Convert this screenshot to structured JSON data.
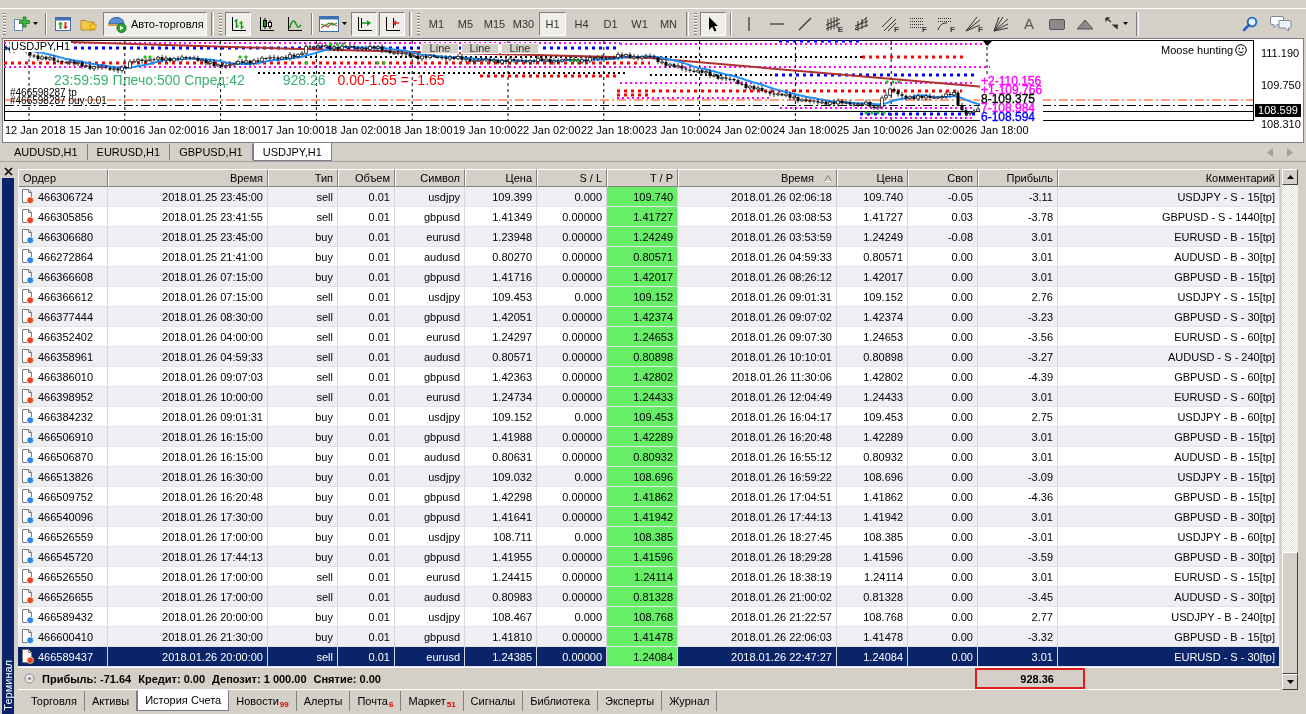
{
  "toolbar": {
    "autotrading": {
      "label": "Авто-торговля",
      "on": true
    },
    "chart_types": [
      {
        "selected": true
      },
      {
        "selected": false
      },
      {
        "selected": false
      }
    ],
    "chart_toggles": [
      {
        "on": true
      },
      {
        "on": true
      }
    ],
    "timeframes": [
      {
        "label": "M1",
        "selected": false
      },
      {
        "label": "M5",
        "selected": false
      },
      {
        "label": "M15",
        "selected": false
      },
      {
        "label": "M30",
        "selected": false
      },
      {
        "label": "H1",
        "selected": true
      },
      {
        "label": "H4",
        "selected": false
      },
      {
        "label": "D1",
        "selected": false
      },
      {
        "label": "W1",
        "selected": false
      },
      {
        "label": "MN",
        "selected": false
      }
    ],
    "drawing_tools": [
      {
        "kind": "icon",
        "selected": true
      },
      {
        "kind": "icon",
        "selected": false
      },
      {
        "kind": "icon",
        "selected": false
      },
      {
        "kind": "icon",
        "selected": false
      },
      {
        "kind": "icon",
        "selected": false,
        "subscript": "E"
      },
      {
        "kind": "icon",
        "selected": false
      },
      {
        "kind": "icon",
        "selected": false,
        "subscript": "F"
      },
      {
        "kind": "icon",
        "selected": false,
        "subscript": "F"
      },
      {
        "kind": "icon",
        "selected": false,
        "subscript": "F"
      },
      {
        "kind": "icon",
        "selected": false,
        "subscript": "F"
      },
      {
        "kind": "icon",
        "selected": false
      },
      {
        "kind": "text",
        "label": "A",
        "selected": false
      },
      {
        "kind": "icon",
        "selected": false
      },
      {
        "kind": "icon",
        "selected": false
      },
      {
        "kind": "dropdown",
        "selected": false
      }
    ]
  },
  "chart": {
    "title": "USDJPY,H1",
    "tags": [
      "Line",
      "Line",
      "Line"
    ],
    "info": "23:59:59 Плечо:500 Спред:42",
    "equity": "928.26",
    "profit": "0.00-1.65 = -1.65",
    "order_labels": [
      "#466598287 tp",
      "#466598287 buy 0.01"
    ],
    "expert": "Moose hunting",
    "levels": [
      {
        "label": "+2-110.156",
        "color": "#ff00ff"
      },
      {
        "label": "+1-109.766",
        "color": "#ff00ff"
      },
      {
        "label": "8-109.375",
        "color": "#000000"
      },
      {
        "label": "7-108.984",
        "color": "#ff00ff"
      },
      {
        "label": "6-108.594",
        "color": "#0000ff"
      }
    ],
    "price_ticks": [
      "111.190",
      "109.750",
      "108.310"
    ],
    "bid": "108.599",
    "time_ticks": [
      "12 Jan 2018",
      "15 Jan 10:00",
      "16 Jan 02:00",
      "16 Jan 18:00",
      "17 Jan 10:00",
      "18 Jan 02:00",
      "18 Jan 18:00",
      "19 Jan 10:00",
      "22 Jan 02:00",
      "22 Jan 18:00",
      "23 Jan 10:00",
      "24 Jan 02:00",
      "24 Jan 18:00",
      "25 Jan 10:00",
      "26 Jan 02:00",
      "26 Jan 18:00"
    ]
  },
  "chart_tabs": [
    {
      "label": "AUDUSD,H1",
      "selected": false
    },
    {
      "label": "EURUSD,H1",
      "selected": false
    },
    {
      "label": "GBPUSD,H1",
      "selected": false
    },
    {
      "label": "USDJPY,H1",
      "selected": true
    }
  ],
  "terminal": {
    "title": "Терминал",
    "table": {
      "columns": [
        {
          "label": "Ордер",
          "sorted": false,
          "highlighted": false
        },
        {
          "label": "Время",
          "sorted": false,
          "highlighted": false
        },
        {
          "label": "Тип",
          "sorted": false,
          "highlighted": false
        },
        {
          "label": "Объем",
          "sorted": false,
          "highlighted": false
        },
        {
          "label": "Символ",
          "sorted": false,
          "highlighted": false
        },
        {
          "label": "Цена",
          "sorted": false,
          "highlighted": false
        },
        {
          "label": "S / L",
          "sorted": false,
          "highlighted": false
        },
        {
          "label": "T / P",
          "sorted": false,
          "highlighted": true
        },
        {
          "label": "Время",
          "sorted": true,
          "highlighted": false
        },
        {
          "label": "Цена",
          "sorted": false,
          "highlighted": false
        },
        {
          "label": "Своп",
          "sorted": false,
          "highlighted": false
        },
        {
          "label": "Прибыль",
          "sorted": false,
          "highlighted": false
        },
        {
          "label": "Комментарий",
          "sorted": false,
          "highlighted": false
        }
      ],
      "rows": [
        {
          "kind": "sell",
          "selected": false,
          "cells": [
            "466306724",
            "2018.01.25 23:45:00",
            "sell",
            "0.01",
            "usdjpy",
            "109.399",
            "0.000",
            "109.740",
            "2018.01.26 02:06:18",
            "109.740",
            "-0.05",
            "-3.11",
            "USDJPY - S - 15[tp]"
          ]
        },
        {
          "kind": "sell",
          "selected": false,
          "cells": [
            "466305856",
            "2018.01.25 23:41:55",
            "sell",
            "0.01",
            "gbpusd",
            "1.41349",
            "0.00000",
            "1.41727",
            "2018.01.26 03:08:53",
            "1.41727",
            "0.03",
            "-3.78",
            "GBPUSD - S - 1440[tp]"
          ]
        },
        {
          "kind": "buy",
          "selected": false,
          "cells": [
            "466306680",
            "2018.01.25 23:45:00",
            "buy",
            "0.01",
            "eurusd",
            "1.23948",
            "0.00000",
            "1.24249",
            "2018.01.26 03:53:59",
            "1.24249",
            "-0.08",
            "3.01",
            "EURUSD - B - 15[tp]"
          ]
        },
        {
          "kind": "buy",
          "selected": false,
          "cells": [
            "466272864",
            "2018.01.25 21:41:00",
            "buy",
            "0.01",
            "audusd",
            "0.80270",
            "0.00000",
            "0.80571",
            "2018.01.26 04:59:33",
            "0.80571",
            "0.00",
            "3.01",
            "AUDUSD - B - 30[tp]"
          ]
        },
        {
          "kind": "buy",
          "selected": false,
          "cells": [
            "466366608",
            "2018.01.26 07:15:00",
            "buy",
            "0.01",
            "gbpusd",
            "1.41716",
            "0.00000",
            "1.42017",
            "2018.01.26 08:26:12",
            "1.42017",
            "0.00",
            "3.01",
            "GBPUSD - B - 15[tp]"
          ]
        },
        {
          "kind": "sell",
          "selected": false,
          "cells": [
            "466366612",
            "2018.01.26 07:15:00",
            "sell",
            "0.01",
            "usdjpy",
            "109.453",
            "0.000",
            "109.152",
            "2018.01.26 09:01:31",
            "109.152",
            "0.00",
            "2.76",
            "USDJPY - S - 15[tp]"
          ]
        },
        {
          "kind": "sell",
          "selected": false,
          "cells": [
            "466377444",
            "2018.01.26 08:30:00",
            "sell",
            "0.01",
            "gbpusd",
            "1.42051",
            "0.00000",
            "1.42374",
            "2018.01.26 09:07:02",
            "1.42374",
            "0.00",
            "-3.23",
            "GBPUSD - S - 30[tp]"
          ]
        },
        {
          "kind": "sell",
          "selected": false,
          "cells": [
            "466352402",
            "2018.01.26 04:00:00",
            "sell",
            "0.01",
            "eurusd",
            "1.24297",
            "0.00000",
            "1.24653",
            "2018.01.26 09:07:30",
            "1.24653",
            "0.00",
            "-3.56",
            "EURUSD - S - 60[tp]"
          ]
        },
        {
          "kind": "sell",
          "selected": false,
          "cells": [
            "466358961",
            "2018.01.26 04:59:33",
            "sell",
            "0.01",
            "audusd",
            "0.80571",
            "0.00000",
            "0.80898",
            "2018.01.26 10:10:01",
            "0.80898",
            "0.00",
            "-3.27",
            "AUDUSD - S - 240[tp]"
          ]
        },
        {
          "kind": "sell",
          "selected": false,
          "cells": [
            "466386010",
            "2018.01.26 09:07:03",
            "sell",
            "0.01",
            "gbpusd",
            "1.42363",
            "0.00000",
            "1.42802",
            "2018.01.26 11:30:06",
            "1.42802",
            "0.00",
            "-4.39",
            "GBPUSD - S - 60[tp]"
          ]
        },
        {
          "kind": "sell",
          "selected": false,
          "cells": [
            "466398952",
            "2018.01.26 10:00:00",
            "sell",
            "0.01",
            "eurusd",
            "1.24734",
            "0.00000",
            "1.24433",
            "2018.01.26 12:04:49",
            "1.24433",
            "0.00",
            "3.01",
            "EURUSD - S - 60[tp]"
          ]
        },
        {
          "kind": "buy",
          "selected": false,
          "cells": [
            "466384232",
            "2018.01.26 09:01:31",
            "buy",
            "0.01",
            "usdjpy",
            "109.152",
            "0.000",
            "109.453",
            "2018.01.26 16:04:17",
            "109.453",
            "0.00",
            "2.75",
            "USDJPY - B - 60[tp]"
          ]
        },
        {
          "kind": "buy",
          "selected": false,
          "cells": [
            "466506910",
            "2018.01.26 16:15:00",
            "buy",
            "0.01",
            "gbpusd",
            "1.41988",
            "0.00000",
            "1.42289",
            "2018.01.26 16:20:48",
            "1.42289",
            "0.00",
            "3.01",
            "GBPUSD - B - 15[tp]"
          ]
        },
        {
          "kind": "buy",
          "selected": false,
          "cells": [
            "466506870",
            "2018.01.26 16:15:00",
            "buy",
            "0.01",
            "audusd",
            "0.80631",
            "0.00000",
            "0.80932",
            "2018.01.26 16:55:12",
            "0.80932",
            "0.00",
            "3.01",
            "AUDUSD - B - 15[tp]"
          ]
        },
        {
          "kind": "buy",
          "selected": false,
          "cells": [
            "466513826",
            "2018.01.26 16:30:00",
            "buy",
            "0.01",
            "usdjpy",
            "109.032",
            "0.000",
            "108.696",
            "2018.01.26 16:59:22",
            "108.696",
            "0.00",
            "-3.09",
            "USDJPY - B - 15[tp]"
          ]
        },
        {
          "kind": "buy",
          "selected": false,
          "cells": [
            "466509752",
            "2018.01.26 16:20:48",
            "buy",
            "0.01",
            "gbpusd",
            "1.42298",
            "0.00000",
            "1.41862",
            "2018.01.26 17:04:51",
            "1.41862",
            "0.00",
            "-4.36",
            "GBPUSD - B - 15[tp]"
          ]
        },
        {
          "kind": "buy",
          "selected": false,
          "cells": [
            "466540096",
            "2018.01.26 17:30:00",
            "buy",
            "0.01",
            "gbpusd",
            "1.41641",
            "0.00000",
            "1.41942",
            "2018.01.26 17:44:13",
            "1.41942",
            "0.00",
            "3.01",
            "GBPUSD - B - 30[tp]"
          ]
        },
        {
          "kind": "buy",
          "selected": false,
          "cells": [
            "466526559",
            "2018.01.26 17:00:00",
            "buy",
            "0.01",
            "usdjpy",
            "108.711",
            "0.000",
            "108.385",
            "2018.01.26 18:27:45",
            "108.385",
            "0.00",
            "-3.01",
            "USDJPY - B - 60[tp]"
          ]
        },
        {
          "kind": "buy",
          "selected": false,
          "cells": [
            "466545720",
            "2018.01.26 17:44:13",
            "buy",
            "0.01",
            "gbpusd",
            "1.41955",
            "0.00000",
            "1.41596",
            "2018.01.26 18:29:28",
            "1.41596",
            "0.00",
            "-3.59",
            "GBPUSD - B - 30[tp]"
          ]
        },
        {
          "kind": "sell",
          "selected": false,
          "cells": [
            "466526550",
            "2018.01.26 17:00:00",
            "sell",
            "0.01",
            "eurusd",
            "1.24415",
            "0.00000",
            "1.24114",
            "2018.01.26 18:38:19",
            "1.24114",
            "0.00",
            "3.01",
            "EURUSD - S - 15[tp]"
          ]
        },
        {
          "kind": "sell",
          "selected": false,
          "cells": [
            "466526655",
            "2018.01.26 17:00:00",
            "sell",
            "0.01",
            "audusd",
            "0.80983",
            "0.00000",
            "0.81328",
            "2018.01.26 21:00:02",
            "0.81328",
            "0.00",
            "-3.45",
            "AUDUSD - S - 30[tp]"
          ]
        },
        {
          "kind": "buy",
          "selected": false,
          "cells": [
            "466589432",
            "2018.01.26 20:00:00",
            "buy",
            "0.01",
            "usdjpy",
            "108.467",
            "0.000",
            "108.768",
            "2018.01.26 21:22:57",
            "108.768",
            "0.00",
            "2.77",
            "USDJPY - B - 240[tp]"
          ]
        },
        {
          "kind": "buy",
          "selected": false,
          "cells": [
            "466600410",
            "2018.01.26 21:30:00",
            "buy",
            "0.01",
            "gbpusd",
            "1.41810",
            "0.00000",
            "1.41478",
            "2018.01.26 22:06:03",
            "1.41478",
            "0.00",
            "-3.32",
            "GBPUSD - B - 15[tp]"
          ]
        },
        {
          "kind": "sell",
          "selected": true,
          "cells": [
            "466589437",
            "2018.01.26 20:00:00",
            "sell",
            "0.01",
            "eurusd",
            "1.24385",
            "0.00000",
            "1.24084",
            "2018.01.26 22:47:27",
            "1.24084",
            "0.00",
            "3.01",
            "EURUSD - S - 30[tp]"
          ]
        }
      ]
    },
    "summary": {
      "items": [
        "Прибыль: -71.64",
        "Кредит: 0.00",
        "Депозит: 1 000.00",
        "Снятие: 0.00"
      ],
      "total": {
        "text": "928.36",
        "highlighted": true
      }
    },
    "tabs": [
      {
        "label": "Торговля",
        "selected": false
      },
      {
        "label": "Активы",
        "selected": false
      },
      {
        "label": "История Счета",
        "selected": true
      },
      {
        "label": "Новости",
        "badge": "99",
        "selected": false
      },
      {
        "label": "Алерты",
        "selected": false
      },
      {
        "label": "Почта",
        "badge": "6",
        "selected": false
      },
      {
        "label": "Маркет",
        "badge": "51",
        "selected": false
      },
      {
        "label": "Сигналы",
        "selected": false
      },
      {
        "label": "Библиотека",
        "selected": false
      },
      {
        "label": "Эксперты",
        "selected": false
      },
      {
        "label": "Журнал",
        "selected": false
      }
    ]
  }
}
